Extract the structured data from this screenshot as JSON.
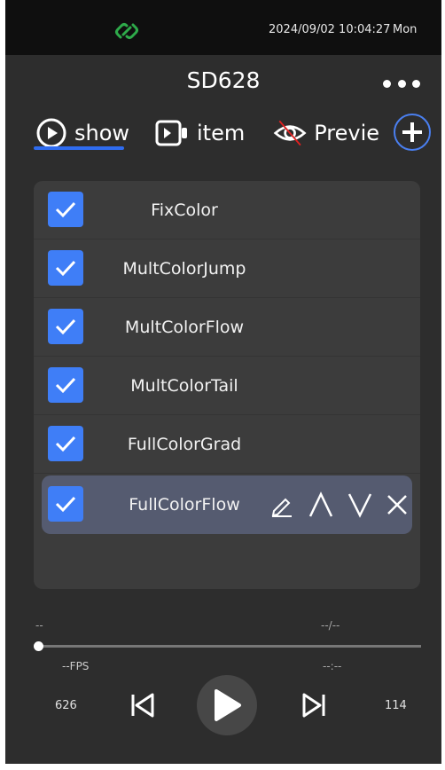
{
  "status_bar": {
    "link_icon": "link-icon",
    "link_color": "#2eaa4a",
    "time": "2024/09/02 10:04:27",
    "day": "Mon"
  },
  "header": {
    "title": "SD628",
    "more_icon": "more-dots-icon"
  },
  "tabs": [
    {
      "label": "show",
      "icon": "play-circle-icon",
      "active": true
    },
    {
      "label": "item",
      "icon": "video-camera-icon"
    },
    {
      "label": "Previe",
      "icon": "eye-crossed-icon"
    }
  ],
  "add_icon": "plus-circle-icon",
  "accent_color": "#2f6cf0",
  "items": [
    {
      "label": "FixColor",
      "checked": true
    },
    {
      "label": "MultColorJump",
      "checked": true
    },
    {
      "label": "MultColorFlow",
      "checked": true
    },
    {
      "label": "MultColorTail",
      "checked": true
    },
    {
      "label": "FullColorGrad",
      "checked": true
    },
    {
      "label": "FullColorFlow",
      "checked": true,
      "selected": true
    }
  ],
  "row_actions": [
    "pencil-icon",
    "chevron-up-icon",
    "chevron-down-icon",
    "close-icon"
  ],
  "player": {
    "progress_left": "--",
    "progress_right": "--/--",
    "progress": 0,
    "fps": "--FPS",
    "timecode": "--:--",
    "count_left": "626",
    "count_right": "114"
  }
}
